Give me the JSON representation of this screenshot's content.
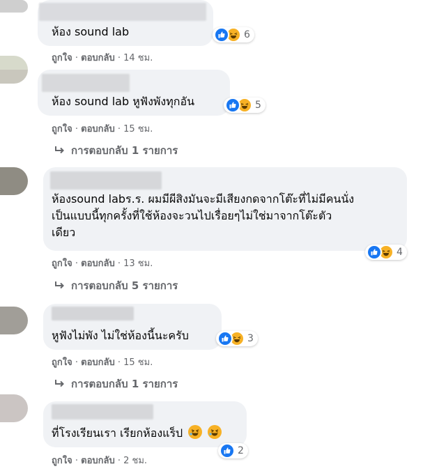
{
  "reaction_icons": {
    "like": "like-icon",
    "haha": "haha-icon"
  },
  "colors": {
    "bubble": "#f0f2f5",
    "meta": "#65676b",
    "like": "#1877f2",
    "haha": "#f7b125"
  },
  "comments": [
    {
      "text": "ห้อง sound lab",
      "reaction_count": "6",
      "like_label": "ถูกใจ",
      "reply_label": "ตอบกลับ",
      "time": "14 ชม."
    },
    {
      "text": "ห้อง sound lab หูฟังพังทุกอัน",
      "reaction_count": "5",
      "like_label": "ถูกใจ",
      "reply_label": "ตอบกลับ",
      "time": "15 ชม.",
      "replies_link": "การตอบกลับ 1 รายการ"
    },
    {
      "text_lines": [
        "ห้องsound labร.ร. ผมมีผีสิงมันจะมีเสียงกดจากโต๊ะที่ไม่มีคนนั่ง",
        "เป็นแบบนี้ทุกครั้งที่ใช้ห้องจะวนไปเรื่อยๆไม่ใช่มาจากโต๊ะตัว",
        "เดียว"
      ],
      "reaction_count": "4",
      "like_label": "ถูกใจ",
      "reply_label": "ตอบกลับ",
      "time": "13 ชม.",
      "replies_link": "การตอบกลับ 5 รายการ"
    },
    {
      "text": "หูฟังไม่พัง ไม่ใช่ห้องนี้นะครับ",
      "reaction_count": "3",
      "like_label": "ถูกใจ",
      "reply_label": "ตอบกลับ",
      "time": "15 ชม.",
      "replies_link": "การตอบกลับ 1 รายการ"
    },
    {
      "text": "ที่โรงเรียนเรา เรียกห้องแร็ป",
      "trailing_emoji": "rolling-laughing-emoji",
      "reaction_count": "2",
      "like_label": "ถูกใจ",
      "reply_label": "ตอบกลับ",
      "time": "2 ชม."
    }
  ]
}
